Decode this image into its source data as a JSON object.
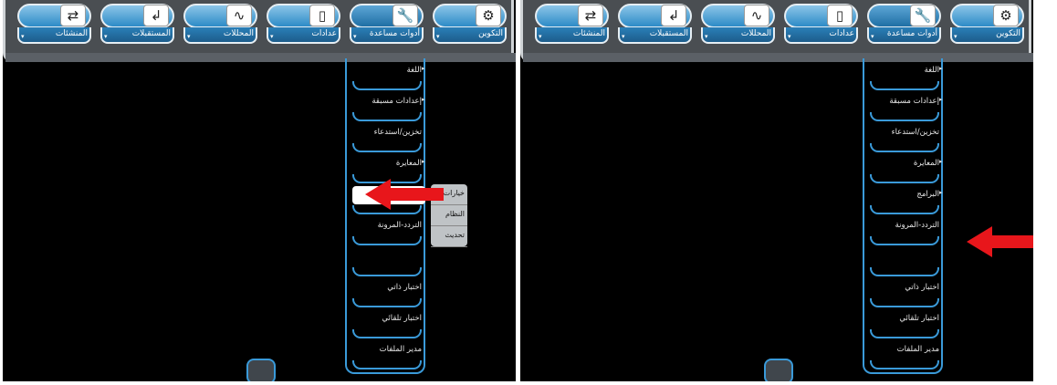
{
  "tabs": [
    {
      "label": "التكوين",
      "icon": "gear-icon",
      "glyph": "⚙"
    },
    {
      "label": "أدوات مساعدة",
      "icon": "wrench-icon",
      "glyph": "🔧"
    },
    {
      "label": "عدادات",
      "icon": "meter-icon",
      "glyph": "▯"
    },
    {
      "label": "المحللات",
      "icon": "graph-icon",
      "glyph": "∿"
    },
    {
      "label": "المستقبلات",
      "icon": "receiver-icon",
      "glyph": "↲"
    },
    {
      "label": "المنشئات",
      "icon": "generator-icon",
      "glyph": "⇄"
    }
  ],
  "left_menu": [
    {
      "label": "اللغة",
      "has_sub": true
    },
    {
      "label": "إعدادات مسبقة",
      "has_sub": true
    },
    {
      "label": "تخزين/استدعاء",
      "has_sub": false
    },
    {
      "label": "المعايرة",
      "has_sub": true
    },
    {
      "label": "",
      "has_sub": false
    },
    {
      "label": "التردد-المرونة",
      "has_sub": false
    },
    {
      "label": "",
      "has_sub": false
    },
    {
      "label": "اختبار ذاتي",
      "has_sub": false
    },
    {
      "label": "اختبار تلقائي",
      "has_sub": false
    },
    {
      "label": "مدير الملفات",
      "has_sub": false
    }
  ],
  "right_menu": [
    {
      "label": "اللغة",
      "has_sub": true
    },
    {
      "label": "إعدادات مسبقة",
      "has_sub": true
    },
    {
      "label": "تخزين/استدعاء",
      "has_sub": false
    },
    {
      "label": "المعايرة",
      "has_sub": true
    },
    {
      "label": "البرامج",
      "has_sub": true
    },
    {
      "label": "التردد-المرونة",
      "has_sub": false
    },
    {
      "label": "",
      "has_sub": false
    },
    {
      "label": "اختبار ذاتي",
      "has_sub": false
    },
    {
      "label": "اختبار تلقائي",
      "has_sub": false
    },
    {
      "label": "مدير الملفات",
      "has_sub": false
    }
  ],
  "submenu": [
    "خيارات",
    "النظام",
    "تحديث"
  ],
  "sub_arrow": "▸",
  "dropdown_arrow": "▾",
  "colors": {
    "accent": "#3a9ad9",
    "arrow": "#e8161b"
  }
}
